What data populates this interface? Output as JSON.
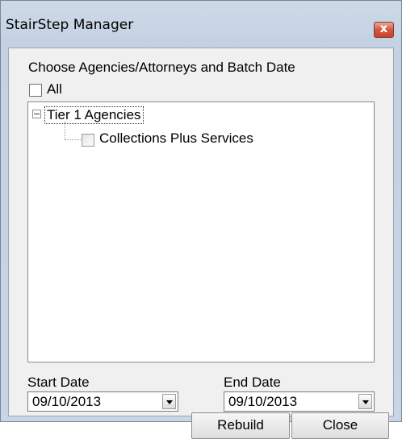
{
  "window": {
    "title": "StairStep Manager",
    "close_glyph": "x"
  },
  "selection": {
    "heading": "Choose Agencies/Attorneys and Batch Date",
    "all_label": "All",
    "all_checked": false
  },
  "tree": {
    "root": {
      "label": "Tier 1 Agencies",
      "expanded": true
    },
    "children": [
      {
        "label": "Collections Plus Services",
        "checked": false
      }
    ]
  },
  "start_date": {
    "label": "Start Date",
    "value": "09/10/2013"
  },
  "end_date": {
    "label": "End Date",
    "value": "09/10/2013"
  },
  "buttons": {
    "rebuild": "Rebuild",
    "close": "Close"
  }
}
